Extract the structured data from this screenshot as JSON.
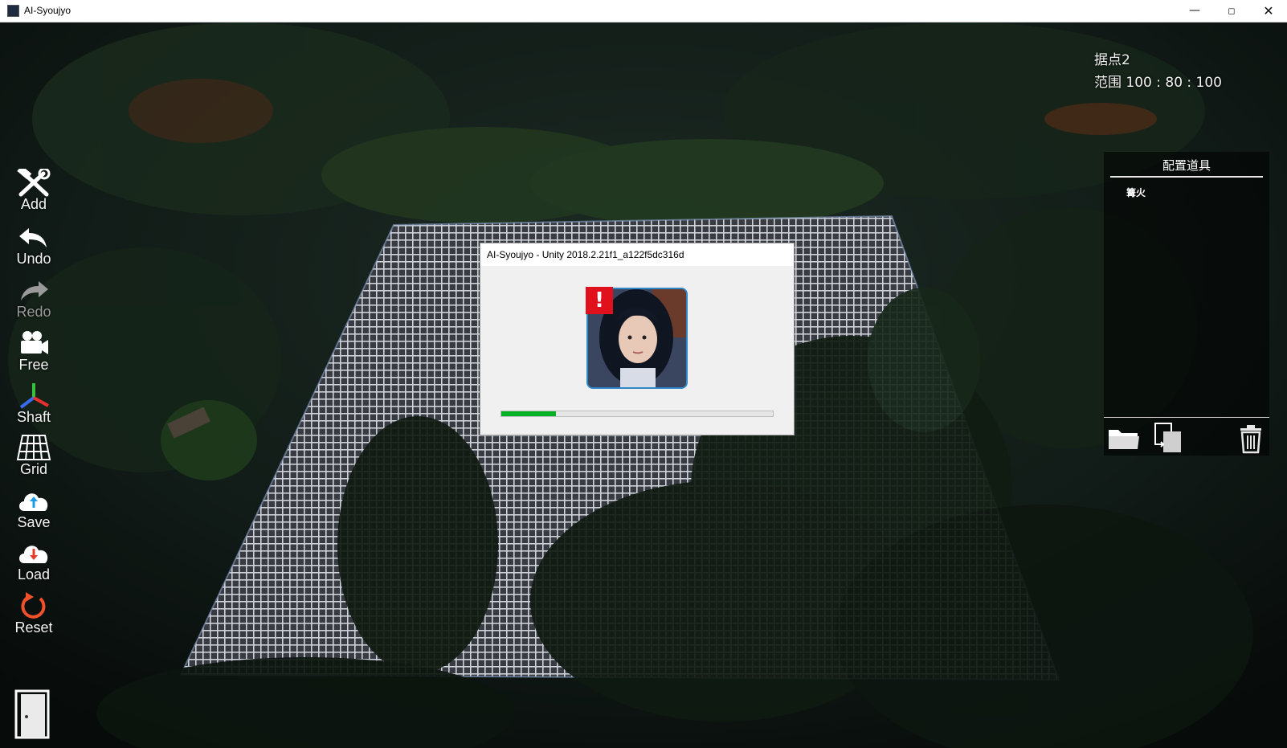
{
  "window": {
    "title": "AI-Syoujyo",
    "minimize": "—",
    "maximize": "◻",
    "close": "✕"
  },
  "hud": {
    "base_name": "据点2",
    "range": "范围 100 : 80 : 100"
  },
  "toolbar": {
    "items": [
      {
        "label": "Add",
        "icon": "hammer-wrench-icon"
      },
      {
        "label": "Undo",
        "icon": "undo-arrow-icon"
      },
      {
        "label": "Redo",
        "icon": "redo-arrow-icon"
      },
      {
        "label": "Free",
        "icon": "video-camera-icon"
      },
      {
        "label": "Shaft",
        "icon": "axis-icon"
      },
      {
        "label": "Grid",
        "icon": "grid-icon"
      },
      {
        "label": "Save",
        "icon": "cloud-upload-icon"
      },
      {
        "label": "Load",
        "icon": "cloud-download-icon"
      },
      {
        "label": "Reset",
        "icon": "reset-icon"
      }
    ],
    "exit_icon": "door-icon"
  },
  "panel": {
    "title": "配置道具",
    "items": [
      "篝火"
    ],
    "buttons": [
      "folder-icon",
      "copy-icon",
      "trash-icon"
    ]
  },
  "dialog": {
    "title": "AI-Syoujyo - Unity 2018.2.21f1_a122f5dc316d",
    "warning_glyph": "!",
    "progress": 0.2
  },
  "colors": {
    "progress_fill": "#06b025",
    "warning": "#e0101c",
    "portrait_border": "#2e88c8"
  }
}
